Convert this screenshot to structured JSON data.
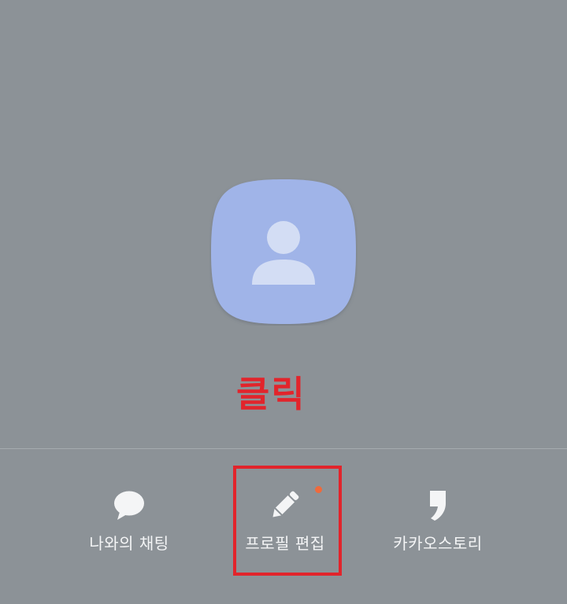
{
  "annotation": {
    "text": "클릭",
    "color": "#e2242b"
  },
  "profile": {
    "avatar_icon": "default-person-avatar",
    "avatar_color": "#a0b4e8"
  },
  "actions": [
    {
      "id": "chat",
      "icon": "speech-bubble-icon",
      "label": "나와의 채팅"
    },
    {
      "id": "edit",
      "icon": "pencil-icon",
      "label": "프로필 편집",
      "has_new_badge": true
    },
    {
      "id": "story",
      "icon": "comma-quote-icon",
      "label": "카카오스토리"
    }
  ],
  "colors": {
    "background": "#8c9297",
    "label": "#f4f5f6",
    "badge": "#ef6a3c",
    "highlight": "#e2242b"
  }
}
